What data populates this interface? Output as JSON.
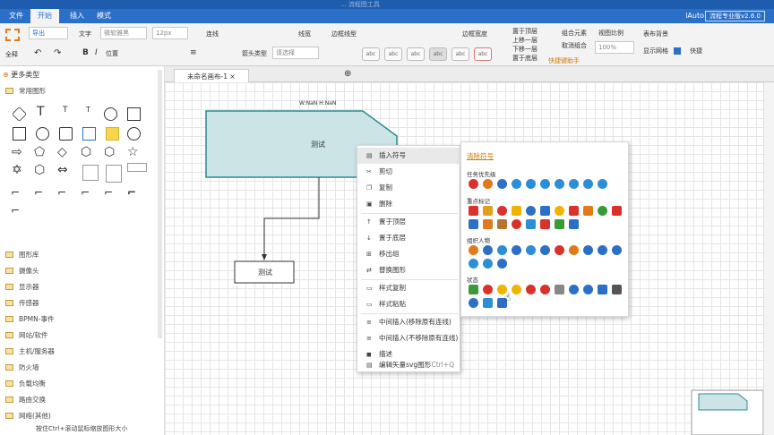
{
  "window": {
    "title": "... 流程图工具"
  },
  "menu": {
    "file": "文件",
    "start": "开始",
    "insert": "插入",
    "mode": "模式",
    "user": "lAuto",
    "version": "流程专业版v2.6.0"
  },
  "toolbar": {
    "select_all": "全释",
    "export": "导出",
    "text_label": "文字",
    "font_family": "微软雅黑",
    "font_size": "12px",
    "line_label": "连线",
    "line_width": "线宽",
    "border_line": "边框线型",
    "connector_width": "边框宽度",
    "arrow_type": "箭头类型",
    "arrow_select": "请选择",
    "style_samples": [
      "abc",
      "abc",
      "abc",
      "abc",
      "abc",
      "abc"
    ],
    "to_top": "置于顶层",
    "up_one": "上移一层",
    "down_one": "下移一层",
    "to_bottom": "置于底层",
    "group": "组合元素",
    "ungroup": "取消组合",
    "quick_assist": "快捷键助手",
    "view_ratio": "视图比例",
    "zoom": "100%",
    "table_bg": "表布背景",
    "show_grid": "显示网格",
    "shortcut": "快捷"
  },
  "sidebar": {
    "header": "更多类型",
    "common": "常用图形",
    "categories": [
      "图形库",
      "摄像头",
      "显示器",
      "传感器",
      "BPMN-事件",
      "网站/软件",
      "主机/服务器",
      "防火墙",
      "负载均衡",
      "路由交换",
      "网络(其他)"
    ]
  },
  "tabs": {
    "doc": "未命名画布-1"
  },
  "canvas": {
    "shape1": "测试",
    "shape2": "测试",
    "size_label": "W:NaN H:NaN"
  },
  "context_menu": {
    "items": [
      "插入符号",
      "剪切",
      "复制",
      "删除",
      "置于顶层",
      "置于底层",
      "移出组",
      "替换图形",
      "样式复制",
      "样式粘贴",
      "中间插入(移除原有连线)",
      "中间插入(不移除原有连线)",
      "描述",
      "编辑矢量svg图形"
    ],
    "shortcut": "Ctrl+Q"
  },
  "symbol_panel": {
    "clear": "清除符号",
    "groups": [
      "任务优先级",
      "重点标记",
      "组织人物",
      "状态"
    ],
    "priorities": [
      "1",
      "2",
      "3",
      "4",
      "5",
      "6",
      "7",
      "8",
      "9",
      "10"
    ]
  },
  "status": {
    "hint": "按住Ctrl+滚动鼠标缩放图形大小"
  }
}
